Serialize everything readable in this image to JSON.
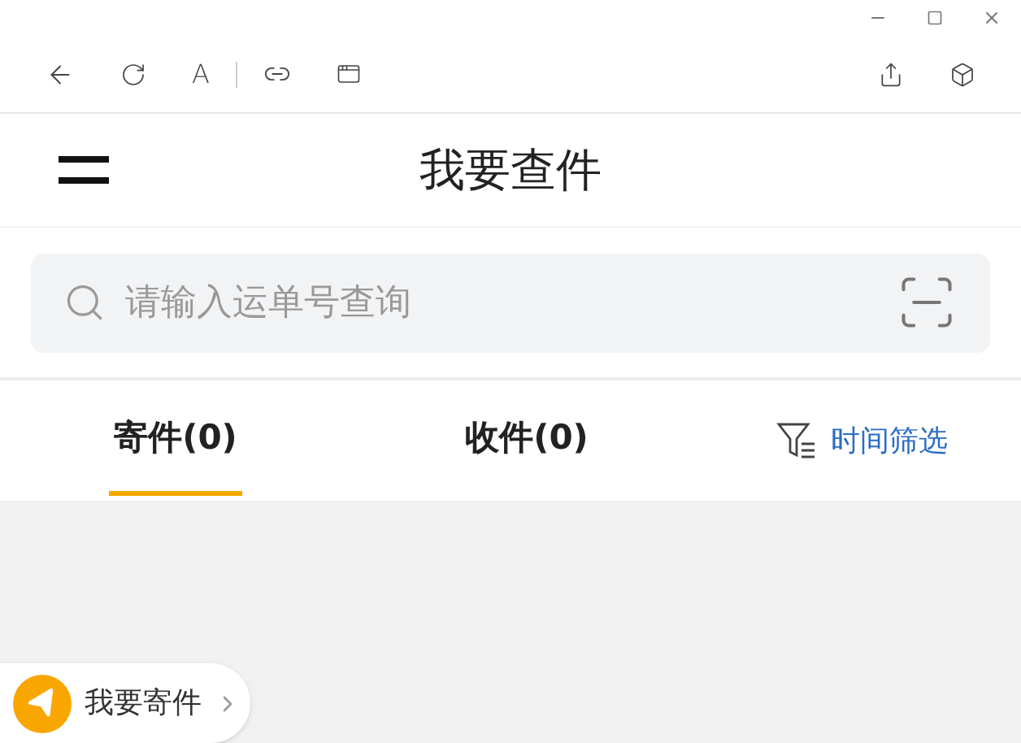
{
  "toolbar": {
    "font_button": "A"
  },
  "header": {
    "title": "我要查件"
  },
  "search": {
    "placeholder": "请输入运单号查询"
  },
  "tabs": [
    {
      "label": "寄件(0)",
      "selected": true
    },
    {
      "label": "收件(0)",
      "selected": false
    }
  ],
  "time_filter": {
    "label": "时间筛选"
  },
  "send_button": {
    "label": "我要寄件"
  }
}
